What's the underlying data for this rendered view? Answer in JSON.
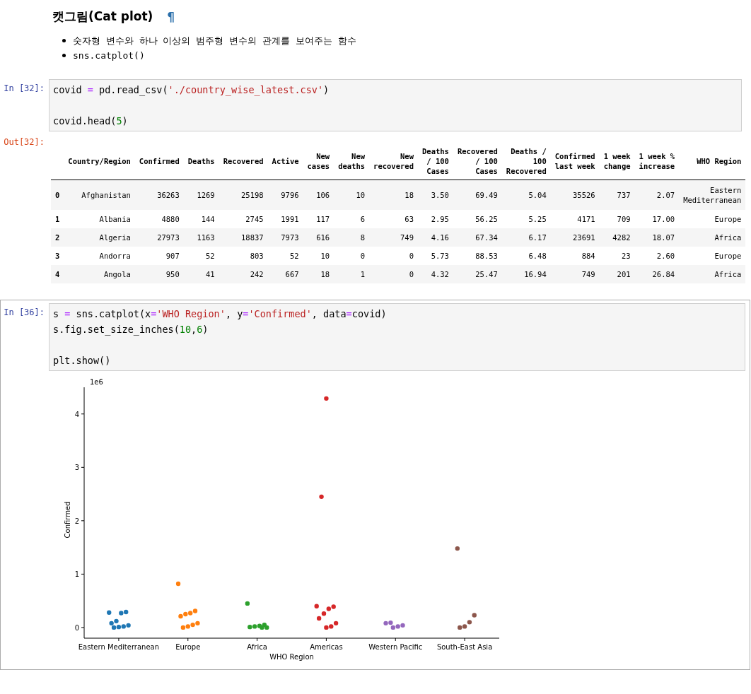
{
  "heading": {
    "text": "캣그림(Cat plot)",
    "anchor": "¶"
  },
  "bullets": [
    "숫자형 변수와 하나 이상의 범주형 변수의 관계를 보여주는 함수",
    "sns.catplot()"
  ],
  "cells": [
    {
      "prompt": "In [32]:",
      "selected": false,
      "code": [
        {
          "text": "covid ",
          "kind": "plain"
        },
        {
          "text": "=",
          "kind": "op"
        },
        {
          "text": " pd.read_csv(",
          "kind": "plain"
        },
        {
          "text": "'./country_wise_latest.csv'",
          "kind": "str"
        },
        {
          "text": ")\n\ncovid.head(",
          "kind": "plain"
        },
        {
          "text": "5",
          "kind": "num"
        },
        {
          "text": ")",
          "kind": "plain"
        }
      ],
      "output": {
        "prompt": "Out[32]:",
        "kind": "table"
      }
    },
    {
      "prompt": "In [36]:",
      "selected": true,
      "code": [
        {
          "text": "s ",
          "kind": "plain"
        },
        {
          "text": "=",
          "kind": "op"
        },
        {
          "text": " sns.catplot(x",
          "kind": "plain"
        },
        {
          "text": "=",
          "kind": "op"
        },
        {
          "text": "'WHO Region'",
          "kind": "str"
        },
        {
          "text": ", y",
          "kind": "plain"
        },
        {
          "text": "=",
          "kind": "op"
        },
        {
          "text": "'Confirmed'",
          "kind": "str"
        },
        {
          "text": ", data",
          "kind": "plain"
        },
        {
          "text": "=",
          "kind": "op"
        },
        {
          "text": "covid)\ns.fig.set_size_inches(",
          "kind": "plain"
        },
        {
          "text": "10",
          "kind": "num"
        },
        {
          "text": ",",
          "kind": "plain"
        },
        {
          "text": "6",
          "kind": "num"
        },
        {
          "text": ")\n\nplt.show()",
          "kind": "plain"
        }
      ],
      "output": {
        "kind": "chart"
      }
    }
  ],
  "table": {
    "columns": [
      "",
      "Country/Region",
      "Confirmed",
      "Deaths",
      "Recovered",
      "Active",
      "New\ncases",
      "New\ndeaths",
      "New\nrecovered",
      "Deaths\n/ 100\nCases",
      "Recovered\n/ 100\nCases",
      "Deaths /\n100\nRecovered",
      "Confirmed\nlast week",
      "1 week\nchange",
      "1 week %\nincrease",
      "WHO Region"
    ],
    "rows": [
      [
        "0",
        "Afghanistan",
        "36263",
        "1269",
        "25198",
        "9796",
        "106",
        "10",
        "18",
        "3.50",
        "69.49",
        "5.04",
        "35526",
        "737",
        "2.07",
        "Eastern\nMediterranean"
      ],
      [
        "1",
        "Albania",
        "4880",
        "144",
        "2745",
        "1991",
        "117",
        "6",
        "63",
        "2.95",
        "56.25",
        "5.25",
        "4171",
        "709",
        "17.00",
        "Europe"
      ],
      [
        "2",
        "Algeria",
        "27973",
        "1163",
        "18837",
        "7973",
        "616",
        "8",
        "749",
        "4.16",
        "67.34",
        "6.17",
        "23691",
        "4282",
        "18.07",
        "Africa"
      ],
      [
        "3",
        "Andorra",
        "907",
        "52",
        "803",
        "52",
        "10",
        "0",
        "0",
        "5.73",
        "88.53",
        "6.48",
        "884",
        "23",
        "2.60",
        "Europe"
      ],
      [
        "4",
        "Angola",
        "950",
        "41",
        "242",
        "667",
        "18",
        "1",
        "0",
        "4.32",
        "25.47",
        "16.94",
        "749",
        "201",
        "26.84",
        "Africa"
      ]
    ]
  },
  "chart_data": {
    "type": "scatter",
    "xlabel": "WHO Region",
    "ylabel": "Confirmed",
    "categories": [
      "Eastern Mediterranean",
      "Europe",
      "Africa",
      "Americas",
      "Western Pacific",
      "South-East Asia"
    ],
    "ylim": [
      -0.2,
      4.5
    ],
    "yticks": [
      0,
      1,
      2,
      3,
      4
    ],
    "annotations": [
      {
        "text": "1e6"
      }
    ],
    "series": [
      {
        "color": "#1f77b4",
        "values": [
          0.28,
          null,
          null,
          null,
          null,
          null
        ]
      },
      {
        "color": "#1f77b4",
        "values": [
          0.29,
          null,
          null,
          null,
          null,
          null
        ]
      },
      {
        "color": "#1f77b4",
        "values": [
          0.27,
          null,
          null,
          null,
          null,
          null
        ]
      },
      {
        "color": "#1f77b4",
        "values": [
          0.12,
          null,
          null,
          null,
          null,
          null
        ]
      },
      {
        "color": "#1f77b4",
        "values": [
          0.08,
          null,
          null,
          null,
          null,
          null
        ]
      },
      {
        "color": "#1f77b4",
        "values": [
          0.04,
          null,
          null,
          null,
          null,
          null
        ]
      },
      {
        "color": "#1f77b4",
        "values": [
          0.02,
          null,
          null,
          null,
          null,
          null
        ]
      },
      {
        "color": "#1f77b4",
        "values": [
          0.01,
          null,
          null,
          null,
          null,
          null
        ]
      },
      {
        "color": "#1f77b4",
        "values": [
          0,
          null,
          null,
          null,
          null,
          null
        ]
      },
      {
        "color": "#ff7f0e",
        "values": [
          null,
          0.82,
          null,
          null,
          null,
          null
        ]
      },
      {
        "color": "#ff7f0e",
        "values": [
          null,
          0.31,
          null,
          null,
          null,
          null
        ]
      },
      {
        "color": "#ff7f0e",
        "values": [
          null,
          0.27,
          null,
          null,
          null,
          null
        ]
      },
      {
        "color": "#ff7f0e",
        "values": [
          null,
          0.25,
          null,
          null,
          null,
          null
        ]
      },
      {
        "color": "#ff7f0e",
        "values": [
          null,
          0.21,
          null,
          null,
          null,
          null
        ]
      },
      {
        "color": "#ff7f0e",
        "values": [
          null,
          0.08,
          null,
          null,
          null,
          null
        ]
      },
      {
        "color": "#ff7f0e",
        "values": [
          null,
          0.05,
          null,
          null,
          null,
          null
        ]
      },
      {
        "color": "#ff7f0e",
        "values": [
          null,
          0.02,
          null,
          null,
          null,
          null
        ]
      },
      {
        "color": "#ff7f0e",
        "values": [
          null,
          0,
          null,
          null,
          null,
          null
        ]
      },
      {
        "color": "#2ca02c",
        "values": [
          null,
          null,
          0.45,
          null,
          null,
          null
        ]
      },
      {
        "color": "#2ca02c",
        "values": [
          null,
          null,
          0.05,
          null,
          null,
          null
        ]
      },
      {
        "color": "#2ca02c",
        "values": [
          null,
          null,
          0.03,
          null,
          null,
          null
        ]
      },
      {
        "color": "#2ca02c",
        "values": [
          null,
          null,
          0.02,
          null,
          null,
          null
        ]
      },
      {
        "color": "#2ca02c",
        "values": [
          null,
          null,
          0.01,
          null,
          null,
          null
        ]
      },
      {
        "color": "#2ca02c",
        "values": [
          null,
          null,
          0,
          null,
          null,
          null
        ]
      },
      {
        "color": "#2ca02c",
        "values": [
          null,
          null,
          0,
          null,
          null,
          null
        ]
      },
      {
        "color": "#d62728",
        "values": [
          null,
          null,
          null,
          4.29,
          null,
          null
        ]
      },
      {
        "color": "#d62728",
        "values": [
          null,
          null,
          null,
          2.45,
          null,
          null
        ]
      },
      {
        "color": "#d62728",
        "values": [
          null,
          null,
          null,
          0.4,
          null,
          null
        ]
      },
      {
        "color": "#d62728",
        "values": [
          null,
          null,
          null,
          0.39,
          null,
          null
        ]
      },
      {
        "color": "#d62728",
        "values": [
          null,
          null,
          null,
          0.35,
          null,
          null
        ]
      },
      {
        "color": "#d62728",
        "values": [
          null,
          null,
          null,
          0.26,
          null,
          null
        ]
      },
      {
        "color": "#d62728",
        "values": [
          null,
          null,
          null,
          0.17,
          null,
          null
        ]
      },
      {
        "color": "#d62728",
        "values": [
          null,
          null,
          null,
          0.08,
          null,
          null
        ]
      },
      {
        "color": "#d62728",
        "values": [
          null,
          null,
          null,
          0.02,
          null,
          null
        ]
      },
      {
        "color": "#d62728",
        "values": [
          null,
          null,
          null,
          0,
          null,
          null
        ]
      },
      {
        "color": "#9467bd",
        "values": [
          null,
          null,
          null,
          null,
          0.09,
          null
        ]
      },
      {
        "color": "#9467bd",
        "values": [
          null,
          null,
          null,
          null,
          0.08,
          null
        ]
      },
      {
        "color": "#9467bd",
        "values": [
          null,
          null,
          null,
          null,
          0.04,
          null
        ]
      },
      {
        "color": "#9467bd",
        "values": [
          null,
          null,
          null,
          null,
          0.02,
          null
        ]
      },
      {
        "color": "#9467bd",
        "values": [
          null,
          null,
          null,
          null,
          0,
          null
        ]
      },
      {
        "color": "#8c564b",
        "values": [
          null,
          null,
          null,
          null,
          null,
          1.48
        ]
      },
      {
        "color": "#8c564b",
        "values": [
          null,
          null,
          null,
          null,
          null,
          0.23
        ]
      },
      {
        "color": "#8c564b",
        "values": [
          null,
          null,
          null,
          null,
          null,
          0.1
        ]
      },
      {
        "color": "#8c564b",
        "values": [
          null,
          null,
          null,
          null,
          null,
          0.02
        ]
      },
      {
        "color": "#8c564b",
        "values": [
          null,
          null,
          null,
          null,
          null,
          0
        ]
      }
    ]
  }
}
